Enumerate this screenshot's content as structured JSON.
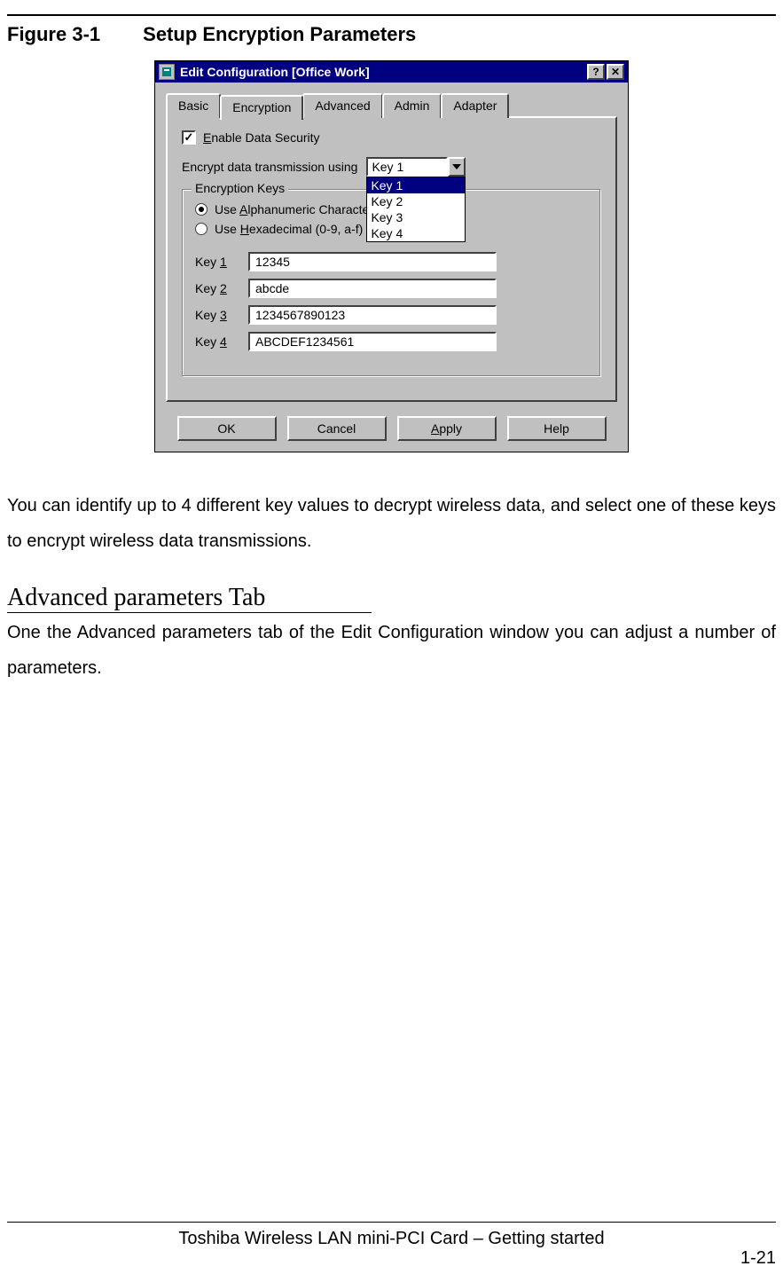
{
  "figure": {
    "num": "Figure 3-1",
    "title": "Setup Encryption Parameters"
  },
  "dialog": {
    "title": "Edit Configuration [Office Work]",
    "help_btn": "?",
    "close_btn": "✕",
    "tabs": [
      "Basic",
      "Encryption",
      "Advanced",
      "Admin",
      "Adapter"
    ],
    "active_tab": "Encryption",
    "enable_label_pre": "E",
    "enable_label_rest": "nable Data Security",
    "encrypt_label": "Encrypt data transmission using ",
    "select_value": "Key 1",
    "dropdown": [
      "Key 1",
      "Key 2",
      "Key 3",
      "Key 4"
    ],
    "group_label": "Encryption Keys",
    "radio1_pre": "Use ",
    "radio1_u": "A",
    "radio1_rest": "lphanumeric Character",
    "radio2_pre": "Use ",
    "radio2_u": "H",
    "radio2_rest": "exadecimal (0-9, a-f)",
    "keys": [
      {
        "label": "Key 1",
        "ul": "1",
        "value": "12345"
      },
      {
        "label": "Key 2",
        "ul": "2",
        "value": "abcde"
      },
      {
        "label": "Key 3",
        "ul": "3",
        "value": "1234567890123"
      },
      {
        "label": "Key 4",
        "ul": "4",
        "value": "ABCDEF1234561"
      }
    ],
    "buttons": {
      "ok": "OK",
      "cancel": "Cancel",
      "apply_u": "A",
      "apply_rest": "pply",
      "help": "Help"
    }
  },
  "para1": "You can identify up to 4 different key values to decrypt wireless data, and select one of these keys to encrypt wireless data transmissions.",
  "section_heading": "Advanced parameters Tab",
  "para2": "One the Advanced parameters tab of the Edit Configuration window you can adjust a number of parameters.",
  "footer": "Toshiba Wireless LAN mini-PCI Card – Getting started",
  "page_num": "1-21"
}
